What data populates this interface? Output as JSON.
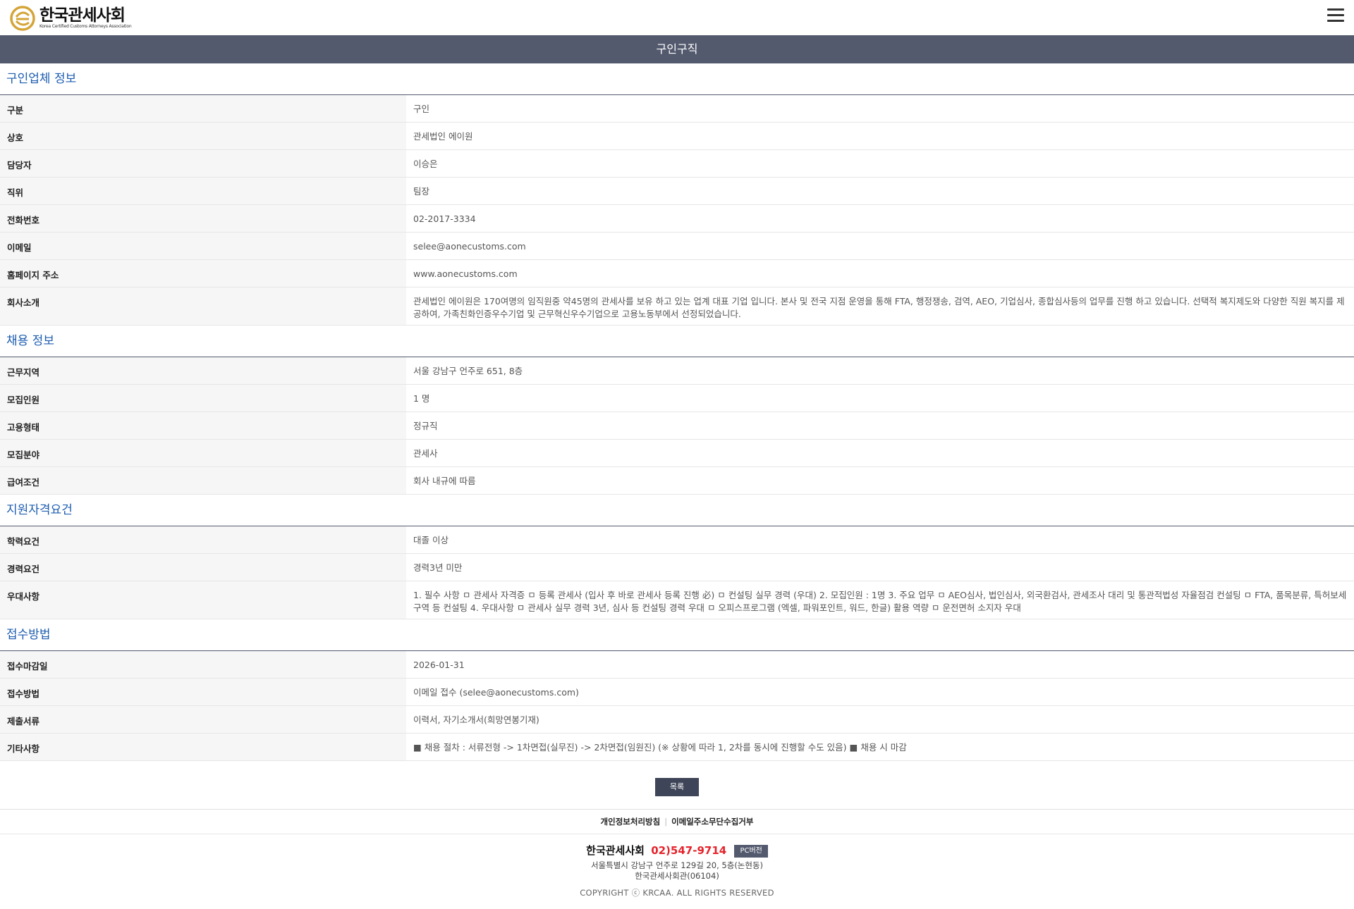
{
  "header": {
    "logo_ko": "한국관세사회",
    "logo_en": "Korea Certified Customs Attorneys Association",
    "menu_icon": "hamburger-menu-icon"
  },
  "page_title": "구인구직",
  "sections": [
    {
      "title": "구인업체 정보",
      "rows": [
        {
          "label": "구분",
          "value": "구인"
        },
        {
          "label": "상호",
          "value": "관세법인 에이원"
        },
        {
          "label": "담당자",
          "value": "이승은"
        },
        {
          "label": "직위",
          "value": "팀장"
        },
        {
          "label": "전화번호",
          "value": "02-2017-3334"
        },
        {
          "label": "이메일",
          "value": "selee@aonecustoms.com"
        },
        {
          "label": "홈페이지 주소",
          "value": "www.aonecustoms.com"
        },
        {
          "label": "회사소개",
          "value": "관세법인 에이원은 170여명의 임직원중 약45명의 관세사를 보유 하고 있는 업계 대표 기업 입니다. 본사 및 전국 지점 운영을 통해 FTA, 행정쟁송, 검역, AEO, 기업심사, 종합심사등의 업무를 진행 하고 있습니다. 선택적 복지제도와 다양한 직원 복지를 제공하여, 가족친화인증우수기업 및 근무혁신우수기업으로 고용노동부에서 선정되었습니다."
        }
      ]
    },
    {
      "title": "채용 정보",
      "rows": [
        {
          "label": "근무지역",
          "value": "서울 강남구 언주로 651, 8층"
        },
        {
          "label": "모집인원",
          "value": "1 명"
        },
        {
          "label": "고용형태",
          "value": "정규직"
        },
        {
          "label": "모집분야",
          "value": "관세사"
        },
        {
          "label": "급여조건",
          "value": "회사 내규에 따름"
        }
      ]
    },
    {
      "title": "지원자격요건",
      "rows": [
        {
          "label": "학력요건",
          "value": "대졸 이상"
        },
        {
          "label": "경력요건",
          "value": "경력3년 미만"
        },
        {
          "label": "우대사항",
          "value": "1. 필수 사항 ㅁ 관세사 자격증 ㅁ 등록 관세사 (입사 후 바로 관세사 등록 진행 必) ㅁ 컨설팅 실무 경력 (우대) 2. 모집인원 : 1명 3. 주요 업무 ㅁ AEO심사, 법인심사, 외국환검사, 관세조사 대리 및 통관적법성 자율점검 컨설팅 ㅁ FTA, 품목분류, 특허보세구역 등 컨설팅 4. 우대사항 ㅁ 관세사 실무 경력 3년, 심사 등 컨설팅 경력 우대 ㅁ 오피스프로그램 (엑셀, 파워포인트, 워드, 한글) 활용 역량 ㅁ 운전면허 소지자 우대"
        }
      ]
    },
    {
      "title": "접수방법",
      "rows": [
        {
          "label": "접수마감일",
          "value": "2026-01-31"
        },
        {
          "label": "접수방법",
          "value": "이메일 접수 (selee@aonecustoms.com)"
        },
        {
          "label": "제출서류",
          "value": "이력서, 자기소개서(희망연봉기재)"
        },
        {
          "label": "기타사항",
          "value": "■ 채용 절차 : 서류전형 -> 1차면접(실무진) -> 2차면접(임원진) (※ 상황에 따라 1, 2차를 동시에 진행할 수도 있음) ■ 채용 시 마감"
        }
      ]
    }
  ],
  "list_button": "목록",
  "footer": {
    "privacy_link": "개인정보처리방침",
    "separator": "|",
    "email_link": "이메일주소무단수집거부",
    "org_name": "한국관세사회",
    "phone": "02)547-9714",
    "pc_button": "PC버전",
    "address_line1": "서울특별시 강남구 언주로 129길 20, 5층(논현동)",
    "address_line2": "한국관세사회관(06104)",
    "copyright": "COPYRIGHT ⓒ KRCAA. ALL RIGHTS RESERVED"
  },
  "colors": {
    "title_bar": "#545a6e",
    "section_title": "#1e5db0",
    "list_button": "#3e4558",
    "phone": "#e5232b",
    "logo_gold": "#d4a437"
  }
}
